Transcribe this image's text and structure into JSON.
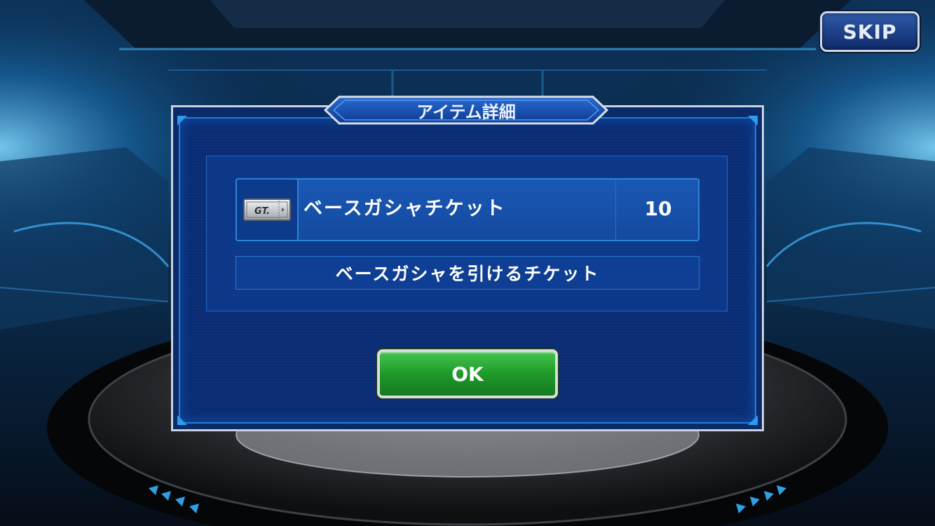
{
  "skip_button": {
    "label": "SKIP"
  },
  "dialog": {
    "title": "アイテム詳細",
    "item": {
      "icon": "gt-ticket-icon",
      "icon_text": "GT.",
      "name": "ベースガシャチケット",
      "quantity": "10"
    },
    "description": "ベースガシャを引けるチケット",
    "ok_label": "OK"
  },
  "colors": {
    "dialog_bg": "#0a2a6a",
    "accent_blue": "#2b9cf0",
    "ok_green": "#1f9a2a",
    "border_silver": "#c9d3df"
  }
}
